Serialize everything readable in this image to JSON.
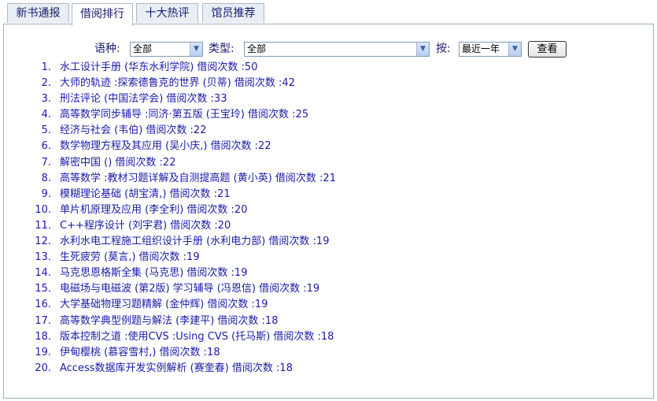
{
  "tabs": [
    {
      "label": "新书通报",
      "active": false
    },
    {
      "label": "借阅排行",
      "active": true
    },
    {
      "label": "十大热评",
      "active": false
    },
    {
      "label": "馆员推荐",
      "active": false
    }
  ],
  "filters": {
    "language_label": "语种:",
    "language_value": "全部",
    "type_label": "类型:",
    "type_value": "全部",
    "by_label": "按:",
    "by_value": "最近一年",
    "view_button": "查看"
  },
  "books": [
    {
      "rank": "1.",
      "text": "水工设计手册 (华东水利学院) 借阅次数 :50"
    },
    {
      "rank": "2.",
      "text": "大师的轨迹 :探索德鲁克的世界 (贝蒂) 借阅次数 :42"
    },
    {
      "rank": "3.",
      "text": "刑法评论 (中国法学会) 借阅次数 :33"
    },
    {
      "rank": "4.",
      "text": "高等数学同步辅导 :同济·第五版 (王宝玲) 借阅次数 :25"
    },
    {
      "rank": "5.",
      "text": "经济与社会 (韦伯) 借阅次数 :22"
    },
    {
      "rank": "6.",
      "text": "数学物理方程及其应用 (吴小庆,) 借阅次数 :22"
    },
    {
      "rank": "7.",
      "text": "解密中国 () 借阅次数 :22"
    },
    {
      "rank": "8.",
      "text": "高等数学 :教材习题详解及自测提高题 (黄小英) 借阅次数 :21"
    },
    {
      "rank": "9.",
      "text": "模糊理论基础 (胡宝清,) 借阅次数 :21"
    },
    {
      "rank": "10.",
      "text": "单片机原理及应用 (李全利) 借阅次数 :20"
    },
    {
      "rank": "11.",
      "text": "C++程序设计 (刘宇君) 借阅次数 :20"
    },
    {
      "rank": "12.",
      "text": "水利水电工程施工组织设计手册 (水利电力部) 借阅次数 :19"
    },
    {
      "rank": "13.",
      "text": "生死疲劳 (莫言,) 借阅次数 :19"
    },
    {
      "rank": "14.",
      "text": "马克思恩格斯全集 (马克思) 借阅次数 :19"
    },
    {
      "rank": "15.",
      "text": "电磁场与电磁波 (第2版) 学习辅导 (冯恩信) 借阅次数 :19"
    },
    {
      "rank": "16.",
      "text": "大学基础物理习题精解 (金仲辉) 借阅次数 :19"
    },
    {
      "rank": "17.",
      "text": "高等数学典型例题与解法 (李建平) 借阅次数 :18"
    },
    {
      "rank": "18.",
      "text": "版本控制之道 :使用CVS :Using CVS (托马斯) 借阅次数 :18"
    },
    {
      "rank": "19.",
      "text": "伊甸樱桃 (慕容雪村,) 借阅次数 :18"
    },
    {
      "rank": "20.",
      "text": "Access数据库开发实例解析 (赛奎春) 借阅次数 :18"
    }
  ]
}
